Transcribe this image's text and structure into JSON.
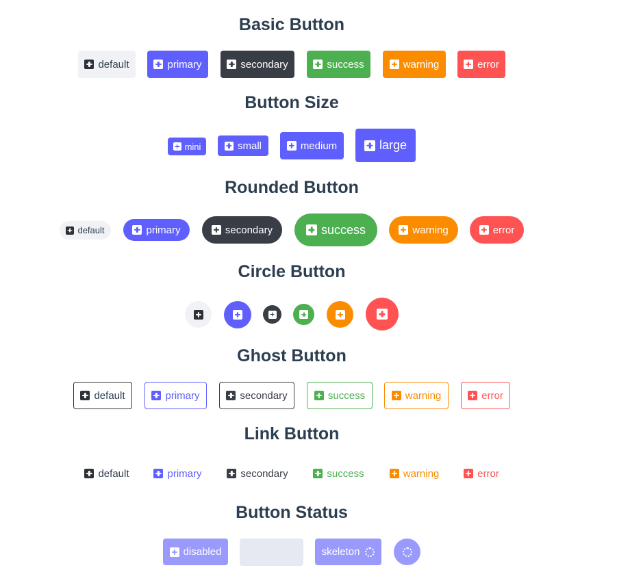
{
  "sections": {
    "basic": "Basic Button",
    "size": "Button Size",
    "rounded": "Rounded Button",
    "circle": "Circle Button",
    "ghost": "Ghost Button",
    "link": "Link Button",
    "status": "Button Status"
  },
  "labels": {
    "default": "default",
    "primary": "primary",
    "secondary": "secondary",
    "success": "success",
    "warning": "warning",
    "error": "error"
  },
  "sizes": {
    "mini": "mini",
    "small": "small",
    "medium": "medium",
    "large": "large"
  },
  "status": {
    "disabled": "disabled",
    "skeleton": "skeleton"
  },
  "icon": "plus-square-icon",
  "colors": {
    "default": "#f1f2f6",
    "primary": "#5f5ffd",
    "secondary": "#393d46",
    "success": "#4caf50",
    "warning": "#fb8c00",
    "error": "#ff5252",
    "text": "#2c3e50"
  }
}
